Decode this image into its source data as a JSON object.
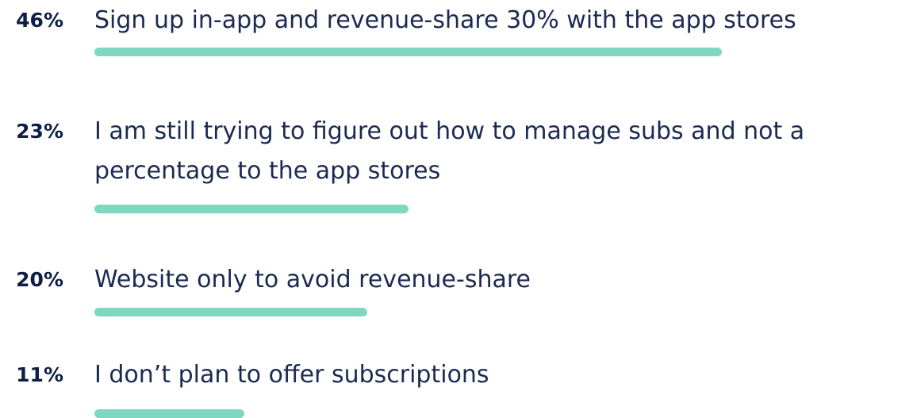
{
  "chart_data": {
    "type": "bar",
    "orientation": "horizontal",
    "categories": [
      "Sign up in-app and revenue-share 30% with the app stores",
      "I am still trying to figure out how to manage subs and not a percentage to the app stores",
      "Website only to avoid revenue-share",
      "I don’t plan to offer subscriptions"
    ],
    "values": [
      46,
      23,
      20,
      11
    ],
    "value_labels": [
      "46%",
      "23%",
      "20%",
      "11%"
    ],
    "unit": "%",
    "xlim": [
      0,
      100
    ],
    "grid": false,
    "legend": "none",
    "bar_color": "#7ed8bf",
    "label_color": "#1c2a52",
    "value_color": "#0e1e44"
  }
}
